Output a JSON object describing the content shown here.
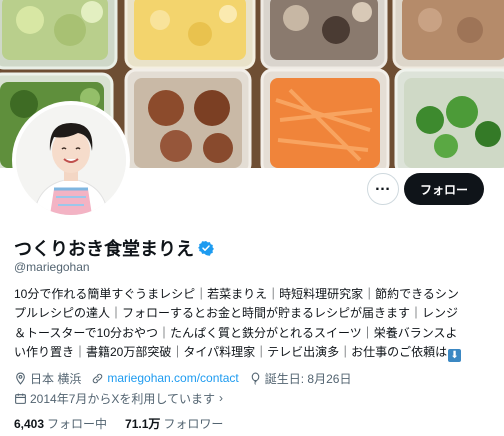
{
  "profile": {
    "display_name": "つくりおき食堂まりえ",
    "handle": "@mariegohan",
    "bio_lines": [
      "10分で作れる簡単すぐうまレシピ｜若菜まりえ｜時短料理研究家｜節約できるシン",
      "プルレシピの達人｜フォローするとお金と時間が貯まるレシピが届きます｜レンジ",
      "＆トースターで10分おやつ｜たんぱく質と鉄分がとれるスイーツ｜栄養バランスよ",
      "い作り置き｜書籍20万部突破｜タイパ料理家｜テレビ出演多｜お仕事のご依頼は"
    ],
    "bio_end_icon": "down-arrow-emoji-icon",
    "location": "日本 横浜",
    "website": "mariegohan.com/contact",
    "birthday": "誕生日: 8月26日",
    "joined": "2014年7月からXを利用しています",
    "following_count": "6,403",
    "following_label": "フォロー中",
    "followers_count": "71.1万",
    "followers_label": "フォロワー"
  },
  "actions": {
    "more_label": "…",
    "follow_label": "フォロー"
  },
  "colors": {
    "verified": "#1d9bf0",
    "link": "#1d9bf0",
    "follow_button": "#0f1419",
    "secondary_text": "#536471"
  },
  "icons": {
    "verified": "verified-badge-icon",
    "location": "location-pin-icon",
    "link": "link-icon",
    "birthday": "balloon-icon",
    "joined_chevron": "chevron-right-icon"
  }
}
